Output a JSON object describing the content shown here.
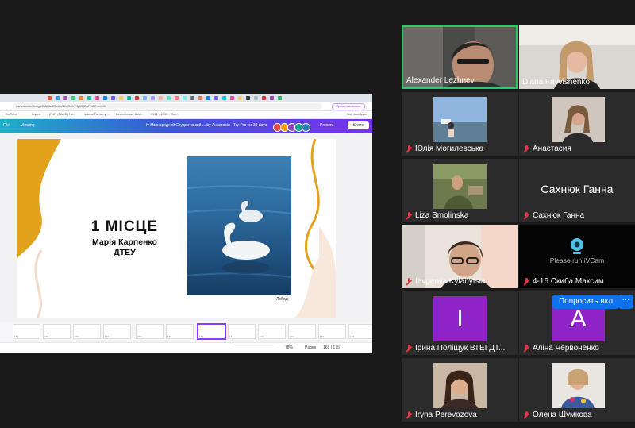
{
  "share": {
    "url": "canva.com/design/DAGsxtGxdKAUrfCaIkY1jWQBMYn3Zrn/edit",
    "profile_label": "Приостановлено",
    "bookmarks": [
      "YouTube",
      "Карта",
      "[ПКП (ПАКО) Но...",
      "Новини Гатчину ...",
      "Бесплатные Шаб...",
      "2021 - 2030 - Тімі...",
      "Все закладки"
    ],
    "canva": {
      "file_label": "File",
      "mode_label": "Viewing",
      "doc_title": "Iv Міжнародний Студентський ... by Анастасія",
      "try_pro": "Try Pro for 30 days",
      "present": "Present",
      "share": "Share"
    },
    "slide": {
      "title": "1 МІСЦЕ",
      "line1": "Марія Карпенко",
      "line2": "ДТЕУ",
      "caption": "Лебеді"
    },
    "thumbs": [
      "164",
      "165",
      "166",
      "167",
      "168",
      "169",
      "170",
      "171",
      "172",
      "173",
      "174",
      "175"
    ],
    "status": {
      "zoom": "78%",
      "pages": "Pages",
      "page_count": "168 / 175"
    }
  },
  "participants": [
    {
      "name": "Alexander Lezhnev"
    },
    {
      "name": "Diana Fayvishenko"
    },
    {
      "name": "Юлія Могилевська"
    },
    {
      "name": "Анастасия"
    },
    {
      "name": "Liza Smolinska"
    },
    {
      "name": "Сахнюк Ганна",
      "big": "Сахнюк Ганна"
    },
    {
      "name": "Ievgeniia Kyianytsia"
    },
    {
      "name": "4-16 Скиба Максим",
      "notice": "Please run iVCam"
    },
    {
      "name": "Ірина Поліщук ВТЕІ ДТ...",
      "letter": "І"
    },
    {
      "name": "Аліна Червоненко",
      "letter": "А"
    },
    {
      "name": "Iryna Perevozova"
    },
    {
      "name": "Олена Шумкова"
    }
  ],
  "controls": {
    "ask_label": "Попросить вкл",
    "more_label": "···"
  },
  "colors": {
    "active_border": "#2ec866",
    "mic_muted": "#e0383e",
    "zoom_blue": "#0e72ed",
    "avatar_purple": "#8e24c7",
    "canva_purple": "#7d2ae8"
  }
}
